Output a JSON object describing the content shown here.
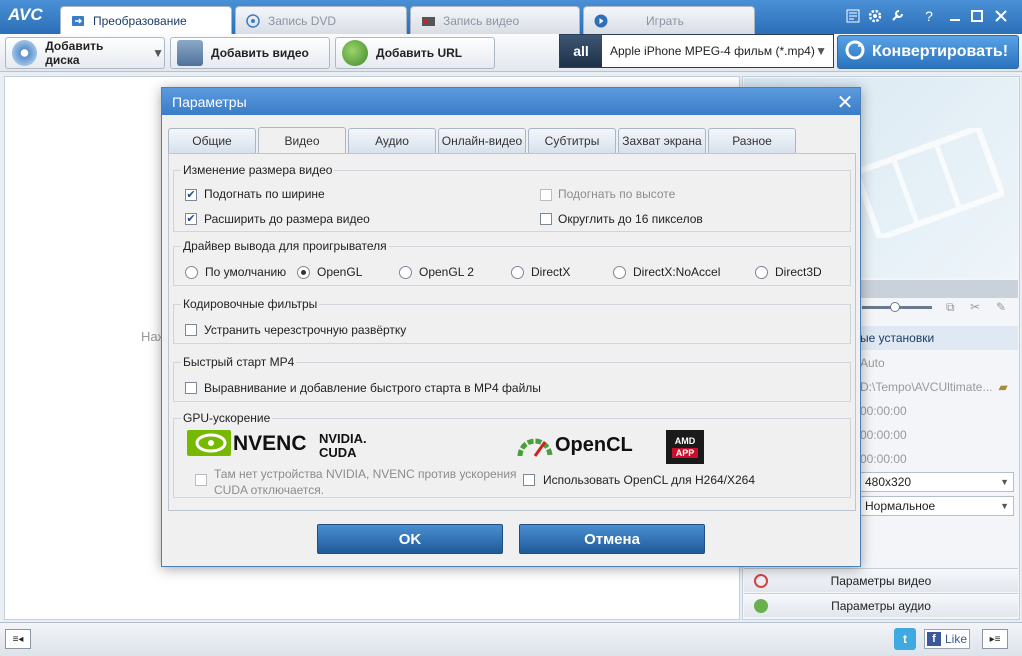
{
  "app": {
    "logo": "AVC"
  },
  "tabs": [
    {
      "label": "Преобразование",
      "active": true
    },
    {
      "label": "Запись DVD",
      "active": false
    },
    {
      "label": "Запись видео",
      "active": false
    },
    {
      "label": "Играть",
      "active": false
    }
  ],
  "toolbar": {
    "add_disc": "Добавить диска",
    "add_video": "Добавить видео",
    "add_url": "Добавить URL",
    "profile_icon_text": "all",
    "profile": "Apple iPhone MPEG-4 фильм (*.mp4)",
    "convert": "Конвертировать!"
  },
  "left_pane": {
    "hint": "Наж"
  },
  "right_pane": {
    "settings_header": "ые установки",
    "rows": [
      "Auto",
      "D:\\Tempo\\AVCUltimate...",
      "00:00:00",
      "00:00:00",
      "00:00:00"
    ],
    "resolution": "480x320",
    "quality": "Нормальное",
    "video_params": "Параметры видео",
    "audio_params": "Параметры аудио"
  },
  "status": {
    "like": "Like"
  },
  "dialog": {
    "title": "Параметры",
    "tabs": [
      "Общие",
      "Видео",
      "Аудио",
      "Онлайн-видео",
      "Субтитры",
      "Захват экрана",
      "Разное"
    ],
    "active_tab": 1,
    "resize": {
      "title": "Изменение размера видео",
      "fit_width": "Подогнать по ширине",
      "fit_width_checked": true,
      "fit_height": "Подогнать по высоте",
      "fit_height_checked": false,
      "expand": "Расширить до размера видео",
      "expand_checked": true,
      "round16": "Округлить до 16 пикселов",
      "round16_checked": false
    },
    "driver": {
      "title": "Драйвер вывода для проигрывателя",
      "options": [
        "По умолчанию",
        "OpenGL",
        "OpenGL 2",
        "DirectX",
        "DirectX:NoAccel",
        "Direct3D"
      ],
      "selected": 1
    },
    "filters": {
      "title": "Кодировочные фильтры",
      "deinterlace": "Устранить черезстрочную развёртку",
      "deinterlace_checked": false
    },
    "mp4": {
      "title": "Быстрый старт MP4",
      "faststart": "Выравнивание и добавление быстрого старта в MP4 файлы",
      "faststart_checked": false
    },
    "gpu": {
      "title": "GPU-ускорение",
      "nvenc": "NVENC",
      "nvidia": "NVIDIA.",
      "cuda": "CUDA",
      "opencl_logo": "OpenCL",
      "amd": "AMD",
      "amd_app": "APP",
      "nvidia_note_1": "Там нет устройства NVIDIA, NVENC против ускорения",
      "nvidia_note_2": "CUDA отключается.",
      "opencl": "Использовать OpenCL для H264/X264",
      "opencl_checked": false
    },
    "ok": "OK",
    "cancel": "Отмена"
  },
  "colors": {
    "accent": "#3a7cc7",
    "nvidia_green": "#76b900",
    "amd_red": "#c8102e"
  }
}
